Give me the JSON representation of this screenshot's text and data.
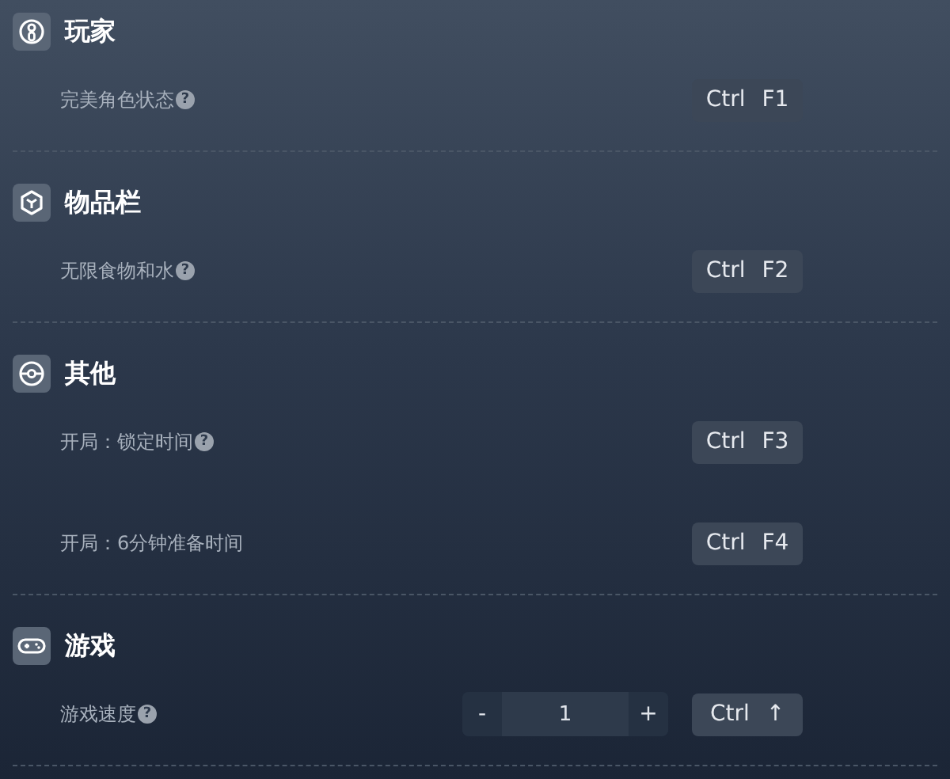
{
  "sections": [
    {
      "title": "玩家",
      "rows": [
        {
          "kind": "toggle",
          "label": "完美角色状态",
          "help": "?",
          "hotkey": "Ctrl F1"
        }
      ]
    },
    {
      "title": "物品栏",
      "rows": [
        {
          "kind": "toggle",
          "label": "无限食物和水",
          "help": "?",
          "hotkey": "Ctrl F2"
        }
      ]
    },
    {
      "title": "其他",
      "rows": [
        {
          "kind": "toggle",
          "label": "开局：锁定时间",
          "help": "?",
          "hotkey": "Ctrl F3"
        },
        {
          "kind": "toggle",
          "label": "开局：6分钟准备时间",
          "hotkey": "Ctrl F4"
        }
      ]
    },
    {
      "title": "游戏",
      "rows": [
        {
          "kind": "stepper",
          "label": "游戏速度",
          "help": "?",
          "minus": "-",
          "value": "1",
          "plus": "+",
          "hotkey": "Ctrl ↑"
        }
      ]
    }
  ]
}
